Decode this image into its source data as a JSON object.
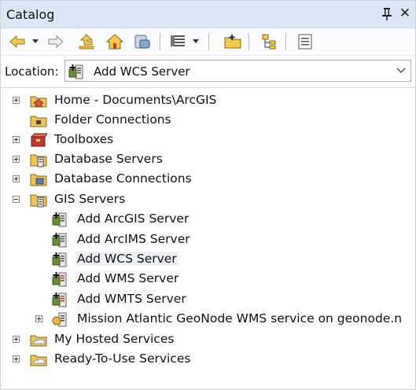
{
  "window": {
    "title": "Catalog"
  },
  "toolbar": {
    "buttons": [
      "back-icon",
      "forward-icon",
      "up-one-level-icon",
      "home-icon",
      "connect-icon",
      "view-icon",
      "connect-folder-icon",
      "toggle-contents-icon",
      "options-icon"
    ]
  },
  "location": {
    "label": "Location:",
    "value": "Add WCS Server"
  },
  "tree": {
    "items": [
      {
        "label": "Home - Documents\\ArcGIS"
      },
      {
        "label": "Folder Connections"
      },
      {
        "label": "Toolboxes"
      },
      {
        "label": "Database Servers"
      },
      {
        "label": "Database Connections"
      },
      {
        "label": "GIS Servers"
      },
      {
        "label": "Add ArcGIS Server"
      },
      {
        "label": "Add ArcIMS Server"
      },
      {
        "label": "Add WCS Server"
      },
      {
        "label": "Add WMS Server"
      },
      {
        "label": "Add WMTS Server"
      },
      {
        "label": "Mission Atlantic GeoNode WMS service on geonode.n"
      },
      {
        "label": "My Hosted Services"
      },
      {
        "label": "Ready-To-Use Services"
      }
    ]
  },
  "colors": {
    "titlebar": "#dbe6f4",
    "selection": "#eef2f7",
    "folder": "#e8c15a"
  }
}
